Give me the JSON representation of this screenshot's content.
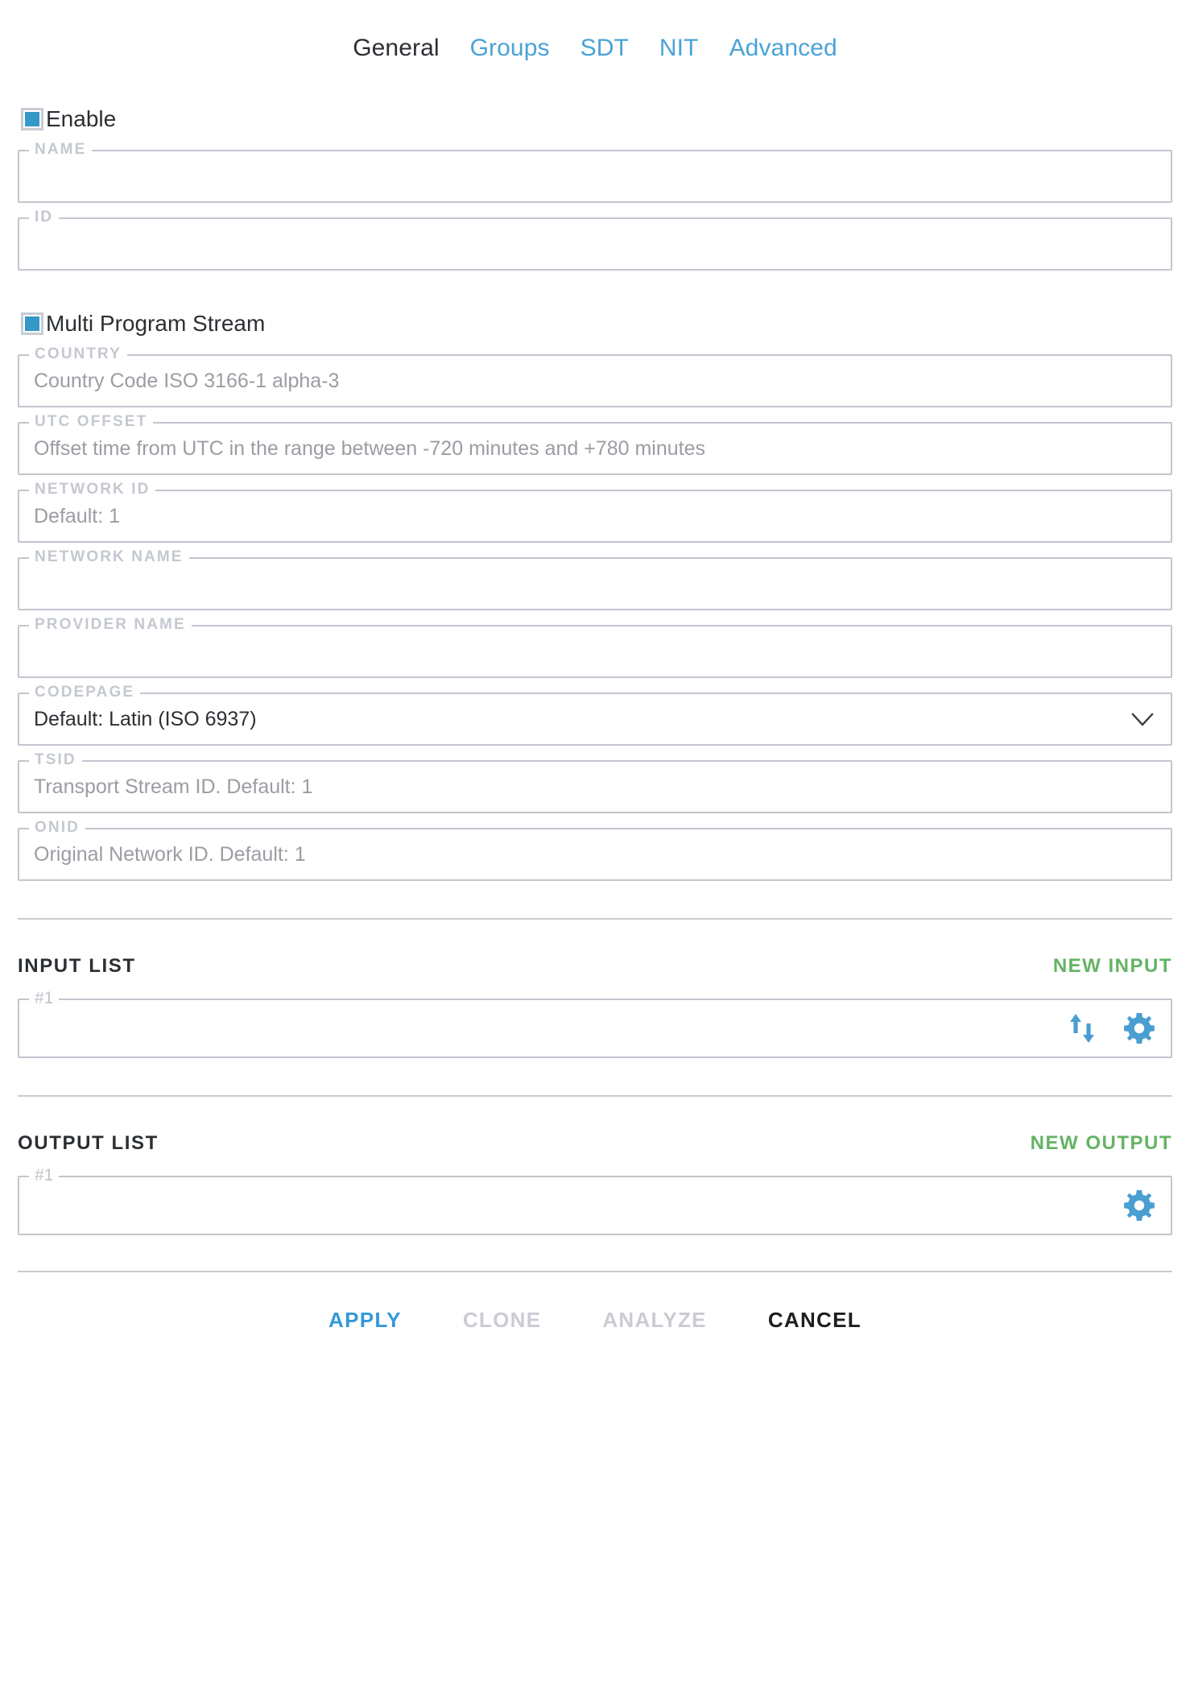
{
  "tabs": [
    {
      "label": "General",
      "active": true
    },
    {
      "label": "Groups",
      "active": false
    },
    {
      "label": "SDT",
      "active": false
    },
    {
      "label": "NIT",
      "active": false
    },
    {
      "label": "Advanced",
      "active": false
    }
  ],
  "checkboxes": {
    "enable": {
      "label": "Enable",
      "checked": true
    },
    "multi_program_stream": {
      "label": "Multi Program Stream",
      "checked": true
    }
  },
  "fields": {
    "name": {
      "legend": "NAME",
      "value": "",
      "placeholder": ""
    },
    "id": {
      "legend": "ID",
      "value": "",
      "placeholder": ""
    },
    "country": {
      "legend": "COUNTRY",
      "value": "",
      "placeholder": "Country Code ISO 3166-1 alpha-3"
    },
    "utc_offset": {
      "legend": "UTC OFFSET",
      "value": "",
      "placeholder": "Offset time from UTC in the range between -720 minutes and +780 minutes"
    },
    "network_id": {
      "legend": "NETWORK ID",
      "value": "",
      "placeholder": "Default: 1"
    },
    "network_name": {
      "legend": "NETWORK NAME",
      "value": "",
      "placeholder": ""
    },
    "provider_name": {
      "legend": "PROVIDER NAME",
      "value": "",
      "placeholder": ""
    },
    "codepage": {
      "legend": "CODEPAGE",
      "value": "Default: Latin (ISO 6937)",
      "placeholder": ""
    },
    "tsid": {
      "legend": "TSID",
      "value": "",
      "placeholder": "Transport Stream ID. Default: 1"
    },
    "onid": {
      "legend": "ONID",
      "value": "",
      "placeholder": "Original Network ID. Default: 1"
    }
  },
  "input_list": {
    "title": "INPUT LIST",
    "action_label": "NEW INPUT",
    "rows": [
      {
        "legend": "#1",
        "value": "",
        "icons": [
          "swap-vertical-icon",
          "gear-icon"
        ]
      }
    ]
  },
  "output_list": {
    "title": "OUTPUT LIST",
    "action_label": "NEW OUTPUT",
    "rows": [
      {
        "legend": "#1",
        "value": "",
        "icons": [
          "gear-icon"
        ]
      }
    ]
  },
  "footer": {
    "apply": "APPLY",
    "clone": "CLONE",
    "analyze": "ANALYZE",
    "cancel": "CANCEL"
  },
  "colors": {
    "accent_blue": "#3498c8",
    "link_blue": "#4aa3d6",
    "green": "#63b363",
    "border_gray": "#c2c6ce",
    "legend_gray": "#c4c8d0",
    "placeholder_gray": "#9a9da3",
    "text_dark": "#2b2f33",
    "disabled_gray": "#c9ccd3"
  }
}
